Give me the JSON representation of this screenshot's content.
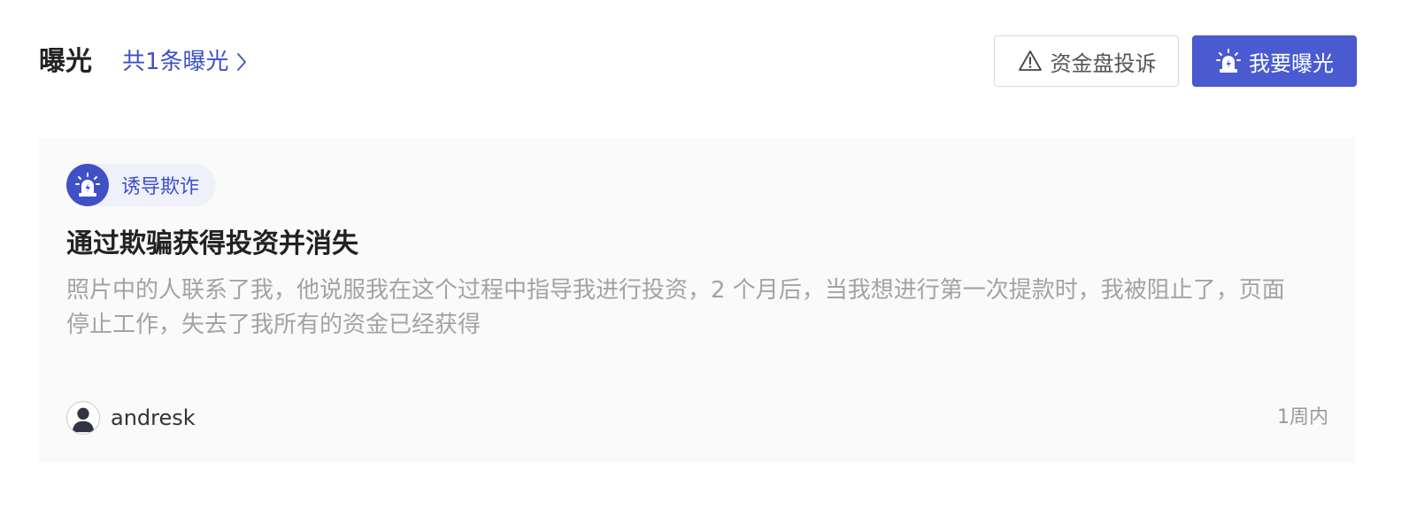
{
  "header": {
    "title": "曝光",
    "count_link": "共1条曝光",
    "complaint_button": "资金盘投诉",
    "expose_button": "我要曝光"
  },
  "card": {
    "tag": "诱导欺诈",
    "title": "通过欺骗获得投资并消失",
    "description": "照片中的人联系了我，他说服我在这个过程中指导我进行投资，2 个月后，当我想进行第一次提款时，我被阻止了，页面停止工作，失去了我所有的资金已经获得",
    "author": "andresk",
    "time": "1周内"
  },
  "icons": {
    "chevron": "chevron-right-icon",
    "complaint": "warning-triangle-icon",
    "expose": "alarm-siren-icon",
    "tag": "alarm-siren-icon",
    "avatar": "user-avatar-icon"
  },
  "colors": {
    "accent": "#3f51c5",
    "button_primary": "#4a5bd1",
    "card_background": "#fafafa",
    "tag_background": "#eef0fa",
    "muted_text": "#a3a3a3"
  }
}
